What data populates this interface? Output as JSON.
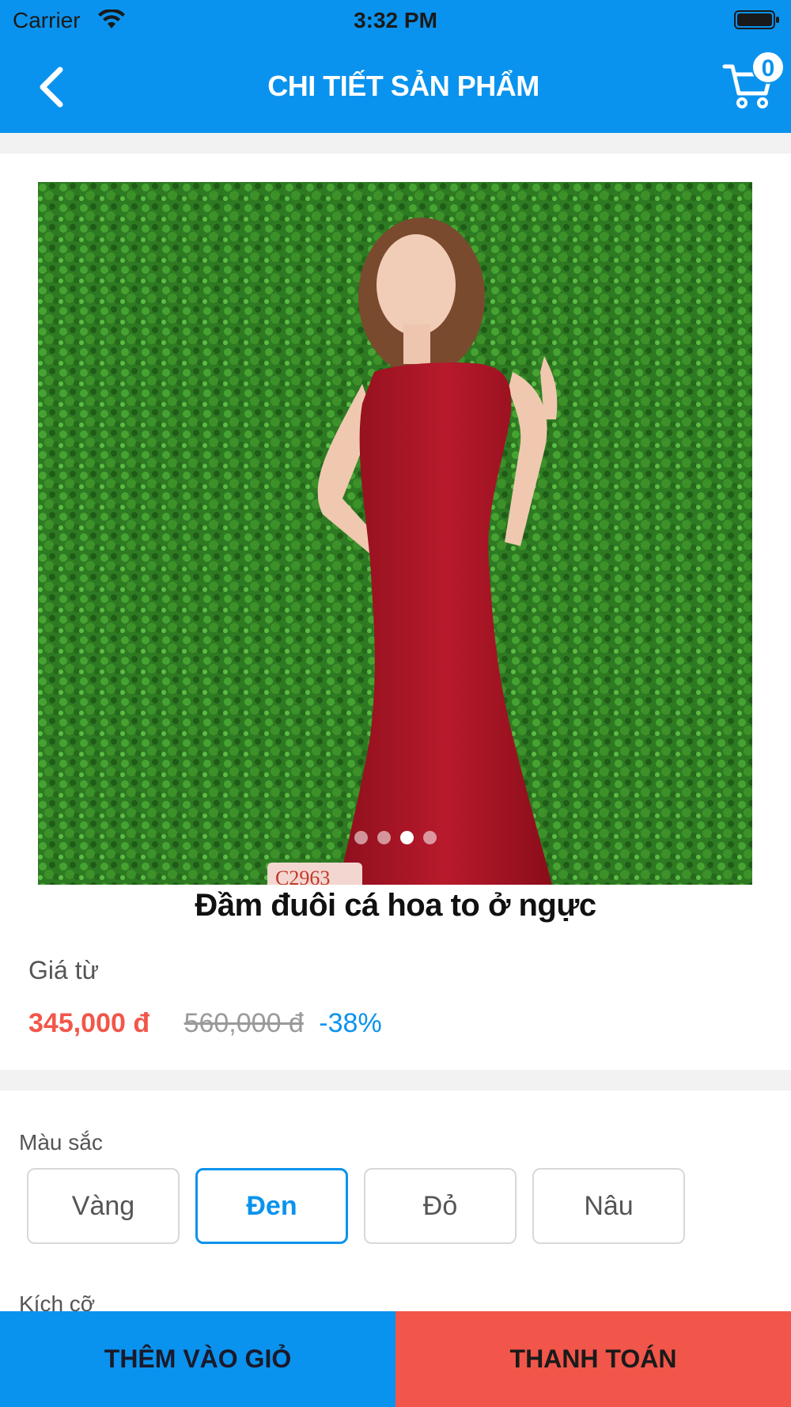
{
  "status_bar": {
    "carrier": "Carrier",
    "time": "3:32 PM"
  },
  "nav": {
    "title": "CHI TIẾT SẢN PHẨM",
    "back_icon": "chevron-left-icon",
    "cart_icon": "cart-icon",
    "cart_count": "0"
  },
  "product": {
    "image_alt_icon": "product-photo",
    "carousel": {
      "count": 4,
      "active_index": 2
    },
    "name": "Đầm đuôi cá hoa to ở ngực",
    "price_label": "Giá từ",
    "price": "345,000 đ",
    "old_price": "560,000 đ",
    "discount": "-38%"
  },
  "options": {
    "color_label": "Màu sắc",
    "colors": [
      {
        "label": "Vàng",
        "selected": false
      },
      {
        "label": "Đen",
        "selected": true
      },
      {
        "label": "Đỏ",
        "selected": false
      },
      {
        "label": "Nâu",
        "selected": false
      }
    ],
    "size_label": "Kích cỡ"
  },
  "actions": {
    "add_to_cart": "THÊM VÀO GIỎ",
    "checkout": "THANH TOÁN"
  },
  "colors": {
    "primary": "#0A93EE",
    "danger": "#F2564A",
    "price": "#F2564A"
  }
}
